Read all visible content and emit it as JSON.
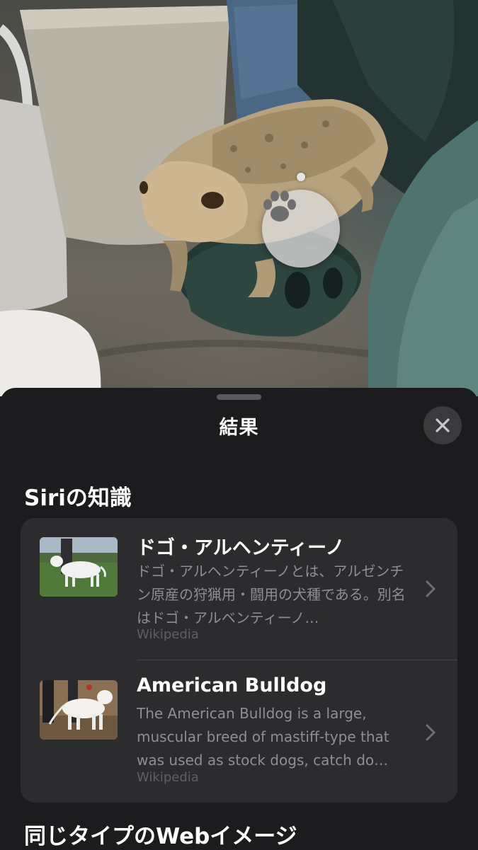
{
  "sheet": {
    "title": "結果",
    "close_icon": "xmark-icon"
  },
  "visual_lookup": {
    "icon": "paw-print-icon"
  },
  "siri_knowledge": {
    "heading": "Siriの知識",
    "results": [
      {
        "title": "ドゴ・アルヘンティーノ",
        "description": "ドゴ・アルヘンティーノとは、アルゼンチン原産の狩猟用・闘用の犬種である。別名はドゴ・アルベンティーノ…",
        "source": "Wikipedia"
      },
      {
        "title": "American Bulldog",
        "description": "The American Bulldog is a large, muscular breed of mastiff-type that was used as stock dogs, catch do…",
        "source": "Wikipedia"
      }
    ]
  },
  "web_images": {
    "heading": "同じタイプのWebイメージ"
  },
  "colors": {
    "sheet_bg": "#1c1c1e",
    "card_bg": "#2c2c2e",
    "secondary_text": "#8e8e93",
    "tertiary_text": "#5f5f64"
  }
}
